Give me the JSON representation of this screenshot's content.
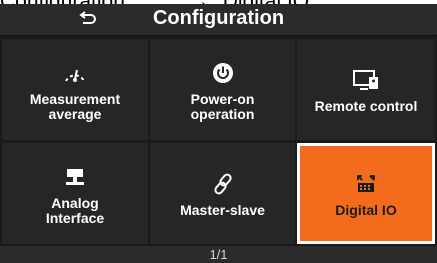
{
  "caption": {
    "left": "Configuration",
    "separator": "→ “",
    "right": "Digital IO”"
  },
  "header": {
    "title": "Configuration",
    "back_icon": "back-arrow-icon"
  },
  "tiles": [
    {
      "label_line1": "Measurement",
      "label_line2": "average",
      "icon": "gauge-icon"
    },
    {
      "label_line1": "Power-on",
      "label_line2": "operation",
      "icon": "power-icon"
    },
    {
      "label_line1": "Remote control",
      "label_line2": "",
      "icon": "remote-screen-icon"
    },
    {
      "label_line1": "Analog",
      "label_line2": "Interface",
      "icon": "analog-interface-icon"
    },
    {
      "label_line1": "Master-slave",
      "label_line2": "",
      "icon": "link-icon"
    },
    {
      "label_line1": "Digital IO",
      "label_line2": "",
      "icon": "digital-io-icon",
      "selected": true
    }
  ],
  "footer": {
    "page": "1/1"
  },
  "colors": {
    "accent": "#f36c1d",
    "background": "#1a1a1a",
    "tile": "#262626"
  }
}
